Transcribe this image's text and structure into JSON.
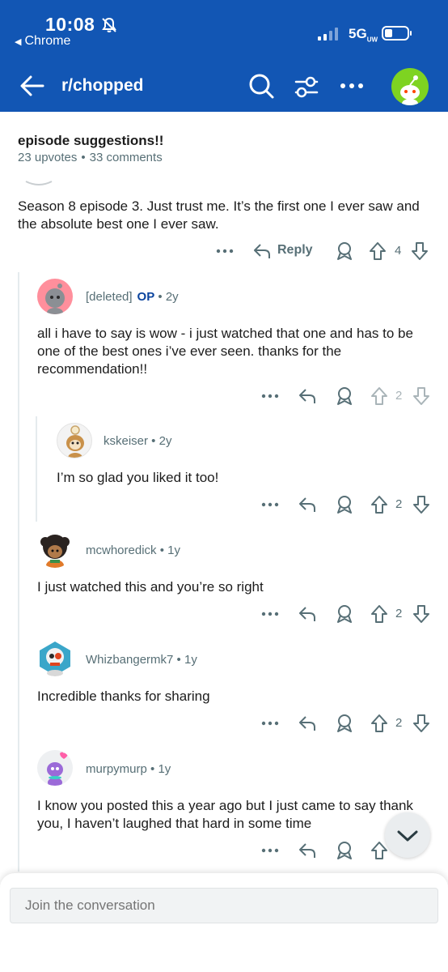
{
  "status_bar": {
    "time": "10:08",
    "back_app": "Chrome",
    "network": "5G",
    "network_sub": "UW"
  },
  "header": {
    "title": "r/chopped"
  },
  "post": {
    "title": "episode suggestions!!",
    "upvotes": "23 upvotes",
    "comments": "33 comments"
  },
  "comments": [
    {
      "text": "Season 8 episode 3. Just trust me. It’s the first one I ever saw and the absolute best one I ever saw.",
      "reply_label": "Reply",
      "votes": "4"
    },
    {
      "username": "[deleted]",
      "op_tag": "OP",
      "age": "2y",
      "text": "all i have to say is wow - i just watched that one and has to be one of the best ones i’ve ever seen. thanks for the recommendation!!",
      "votes": "2"
    },
    {
      "username": "kskeiser",
      "age": "2y",
      "text": "I’m so glad you liked it too!",
      "votes": "2"
    },
    {
      "username": "mcwhoredick",
      "age": "1y",
      "text": "I just watched this and you’re so right",
      "votes": "2"
    },
    {
      "username": "Whizbangermk7",
      "age": "1y",
      "text": "Incredible thanks for sharing",
      "votes": "2"
    },
    {
      "username": "murpymurp",
      "age": "1y",
      "text": "I know you posted this a year ago but I just came to say thank you, I haven’t laughed that hard in some time"
    }
  ],
  "composer": {
    "placeholder": "Join the conversation"
  },
  "colors": {
    "brand_blue": "#1256b4",
    "op_blue": "#0b449e",
    "meta_gray": "#576f76"
  },
  "icons": [
    "bell-slash-icon",
    "signal-icon",
    "battery-icon",
    "back-arrow-icon",
    "search-icon",
    "filter-icon",
    "more-icon",
    "snoo-avatar",
    "reply-icon",
    "award-icon",
    "upvote-icon",
    "downvote-icon",
    "chevron-down-icon"
  ]
}
